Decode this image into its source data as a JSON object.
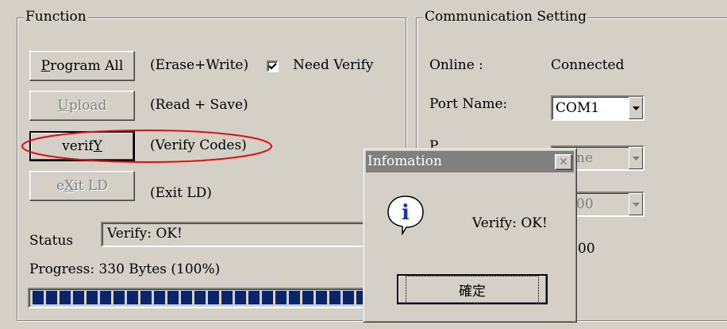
{
  "function": {
    "title": "Function",
    "program_all": "Program All",
    "erase_write": "(Erase+Write)",
    "need_verify": "Need Verify",
    "upload": "Upload",
    "read_save": "(Read + Save)",
    "verify": "verifY",
    "verify_codes": "(Verify Codes)",
    "exit_ld": "eXit LD",
    "exit_ld_desc": "(Exit LD)",
    "status_label": "Status",
    "status_value": "Verify: OK!",
    "progress_label": "Progress: 330 Bytes (100%)",
    "progress_percent": 100
  },
  "communication": {
    "title": "Communication Setting",
    "online_label": "Online :",
    "online_value": "Connected",
    "port_label": "Port Name:",
    "port_value": "COM1",
    "partial_label": "P",
    "partial_combo_1": "ne",
    "partial_combo_2": "00",
    "partial_value_3": "00"
  },
  "dialog": {
    "title": "Infomation",
    "message": "Verify: OK!",
    "ok_button": "確定",
    "close_glyph": "✕",
    "icon_glyph": "i"
  },
  "colors": {
    "face": "#d4d0c8",
    "progress": "#0a246a",
    "highlight_ellipse": "#e01010",
    "info_icon": "#1030d0"
  }
}
